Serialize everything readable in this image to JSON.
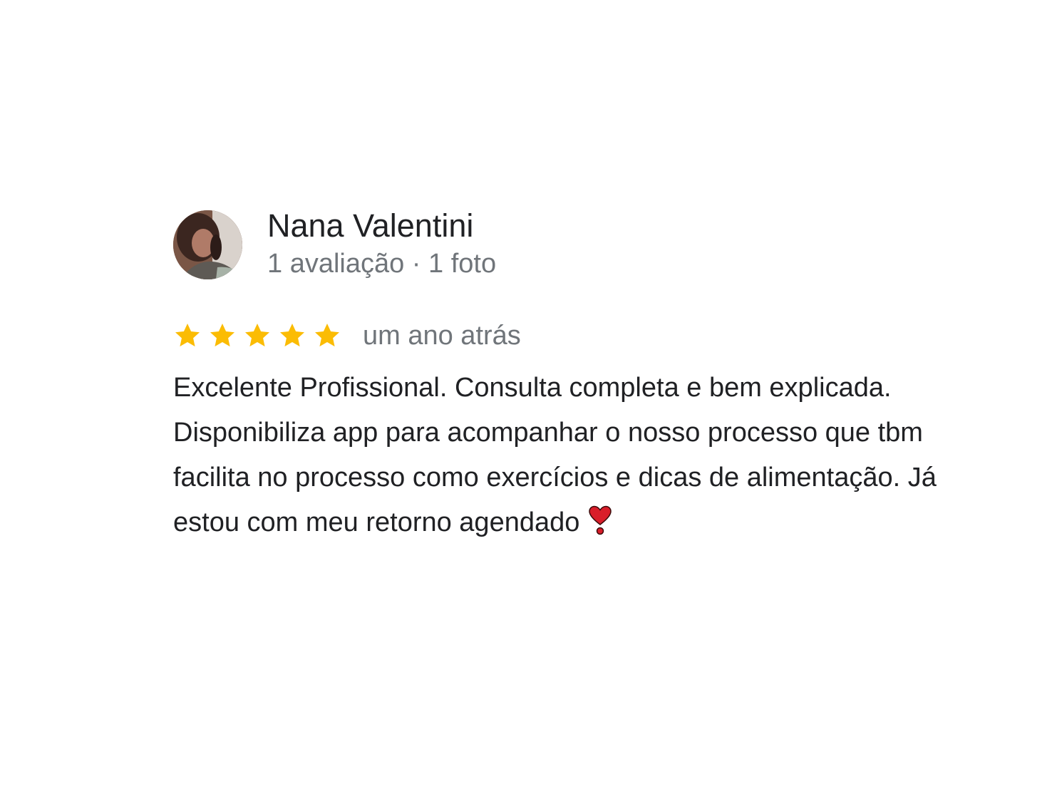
{
  "review": {
    "author_name": "Nana Valentini",
    "author_meta": "1 avaliação · 1 foto",
    "rating": 5,
    "rating_max": 5,
    "date": "um ano atrás",
    "text": "Excelente Profissional. Consulta completa e bem explicada. Disponibiliza app para acompanhar o nosso processo que tbm facilita no processo como exercícios e dicas de alimentação. Já estou com meu retorno agendado",
    "emoji": "heavy-heart-exclamation-icon"
  },
  "colors": {
    "star": "#FBBC04",
    "name": "#202124",
    "secondary": "#70757a",
    "heart": "#d91e2a"
  }
}
